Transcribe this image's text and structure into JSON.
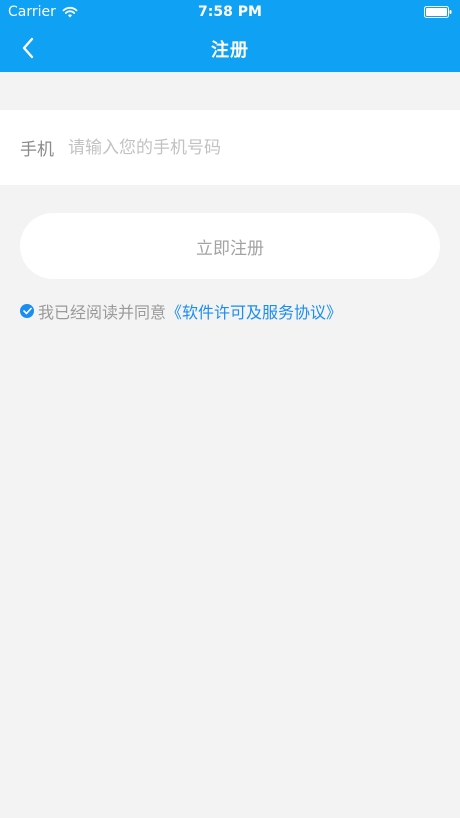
{
  "status_bar": {
    "carrier": "Carrier",
    "time": "7:58 PM"
  },
  "nav": {
    "title": "注册",
    "back_icon": "chevron-left-icon"
  },
  "phone": {
    "label": "手机",
    "value": "",
    "placeholder": "请输入您的手机号码"
  },
  "register_button": {
    "label": "立即注册"
  },
  "agreement": {
    "checked": true,
    "text": "我已经阅读并同意",
    "link_text": "《软件许可及服务协议》"
  },
  "colors": {
    "header": "#0ea1f4",
    "background": "#f3f3f3",
    "link": "#1a8df0"
  }
}
